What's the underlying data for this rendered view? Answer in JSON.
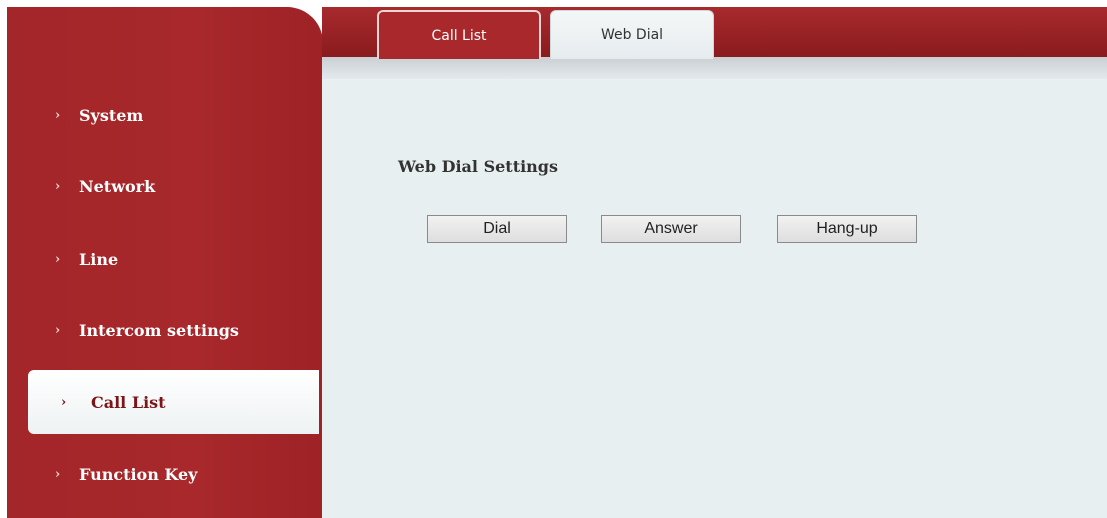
{
  "sidebar": {
    "items": [
      {
        "label": "System"
      },
      {
        "label": "Network"
      },
      {
        "label": "Line"
      },
      {
        "label": "Intercom settings"
      },
      {
        "label": "Call List"
      },
      {
        "label": "Function Key"
      }
    ],
    "chevron": "›"
  },
  "tabs": [
    {
      "label": "Call List"
    },
    {
      "label": "Web Dial"
    }
  ],
  "main": {
    "section_title": "Web Dial Settings",
    "buttons": {
      "dial": "Dial",
      "answer": "Answer",
      "hangup": "Hang-up"
    }
  },
  "colors": {
    "brand_red": "#a8282b",
    "content_bg": "#e8eff1"
  },
  "icons": {
    "nav_chevron": "chevron-right-icon"
  }
}
